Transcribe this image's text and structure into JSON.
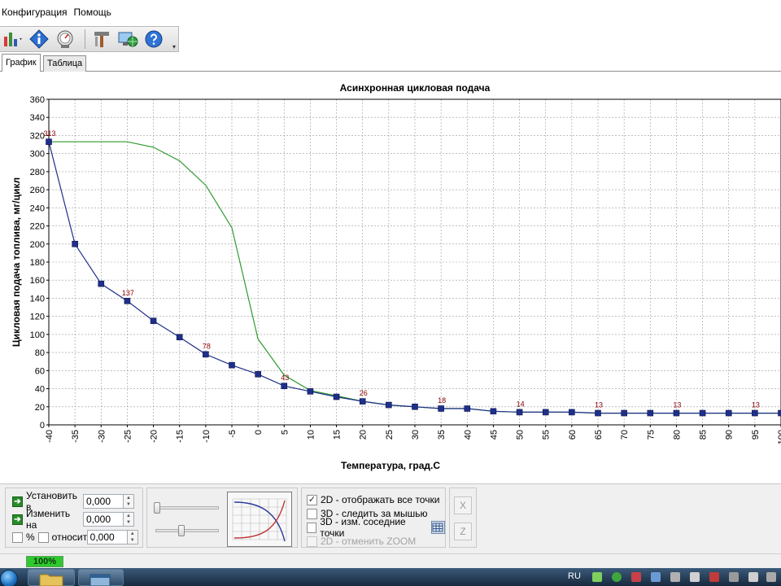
{
  "menu": {
    "items": [
      "Конфигурация",
      "Помощь"
    ]
  },
  "tabs": [
    {
      "label": "График",
      "active": true
    },
    {
      "label": "Таблица",
      "active": false
    }
  ],
  "chart_data": {
    "type": "line",
    "title": "Асинхронная цикловая подача",
    "xlabel": "Температура, град.С",
    "ylabel": "Цикловая подача топлива, мг/цикл",
    "xlim": [
      -40,
      100
    ],
    "ylim": [
      0,
      360
    ],
    "grid": true,
    "xticks": [
      -40,
      -35,
      -30,
      -25,
      -20,
      -15,
      -10,
      -5,
      0,
      5,
      10,
      15,
      20,
      25,
      30,
      35,
      40,
      45,
      50,
      55,
      60,
      65,
      70,
      75,
      80,
      85,
      90,
      95,
      100
    ],
    "yticks": [
      0,
      20,
      40,
      60,
      80,
      100,
      120,
      140,
      160,
      180,
      200,
      220,
      240,
      260,
      280,
      300,
      320,
      340,
      360
    ],
    "series": [
      {
        "color": "#1f2f8a",
        "markers": true,
        "x": [
          -40,
          -35,
          -30,
          -25,
          -20,
          -15,
          -10,
          -5,
          0,
          5,
          10,
          15,
          20,
          25,
          30,
          35,
          40,
          45,
          50,
          55,
          60,
          65,
          70,
          75,
          80,
          85,
          90,
          95,
          100
        ],
        "y": [
          313,
          200,
          156,
          137,
          115,
          97,
          78,
          66,
          56,
          43,
          37,
          31,
          26,
          22,
          20,
          18,
          18,
          15,
          14,
          14,
          14,
          13,
          13,
          13,
          13,
          13,
          13,
          13,
          13
        ]
      },
      {
        "color": "#2e9a2e",
        "markers": false,
        "x": [
          -40,
          -35,
          -30,
          -25,
          -20,
          -15,
          -10,
          -5,
          0,
          5,
          10,
          15,
          20,
          25,
          30,
          35,
          40,
          45,
          50,
          55,
          60,
          65,
          70,
          75,
          80,
          85,
          90,
          95,
          100
        ],
        "y": [
          313,
          313,
          313,
          313,
          307,
          292,
          265,
          218,
          95,
          55,
          38,
          32,
          26,
          22,
          20,
          18,
          18,
          15,
          14,
          14,
          14,
          13,
          13,
          13,
          13,
          13,
          13,
          13,
          13
        ]
      }
    ],
    "labels": [
      {
        "x": -40,
        "y": 313,
        "text": "313"
      },
      {
        "x": -25,
        "y": 137,
        "text": "137"
      },
      {
        "x": -10,
        "y": 78,
        "text": "78"
      },
      {
        "x": 5,
        "y": 43,
        "text": "43"
      },
      {
        "x": 20,
        "y": 26,
        "text": "26"
      },
      {
        "x": 35,
        "y": 18,
        "text": "18"
      },
      {
        "x": 50,
        "y": 14,
        "text": "14"
      },
      {
        "x": 65,
        "y": 13,
        "text": "13"
      },
      {
        "x": 80,
        "y": 13,
        "text": "13"
      },
      {
        "x": 95,
        "y": 13,
        "text": "13"
      }
    ]
  },
  "controls": {
    "set_label": "Установить в",
    "set_value": "0,000",
    "change_label": "Изменить на",
    "change_value": "0,000",
    "percent_label": "%",
    "relative_label": "относит.",
    "relative_value": "0,000"
  },
  "options": {
    "show_all_points": "2D - отображать все точки",
    "follow_mouse": "3D - следить за мышью",
    "edit_neighbors": "3D - изм. соседние точки",
    "cancel_zoom": "2D - отменить ZOOM",
    "show_all_points_checked": true
  },
  "side_buttons": {
    "x": "X",
    "z": "Z"
  },
  "status": {
    "progress_text": "100%",
    "progress": 1.0
  },
  "taskbar": {
    "lang": "RU"
  },
  "colors": {
    "accent": "#1f2f8a",
    "secondary": "#2e9a2e",
    "label": "#8b0000",
    "progress": "#37d137"
  }
}
